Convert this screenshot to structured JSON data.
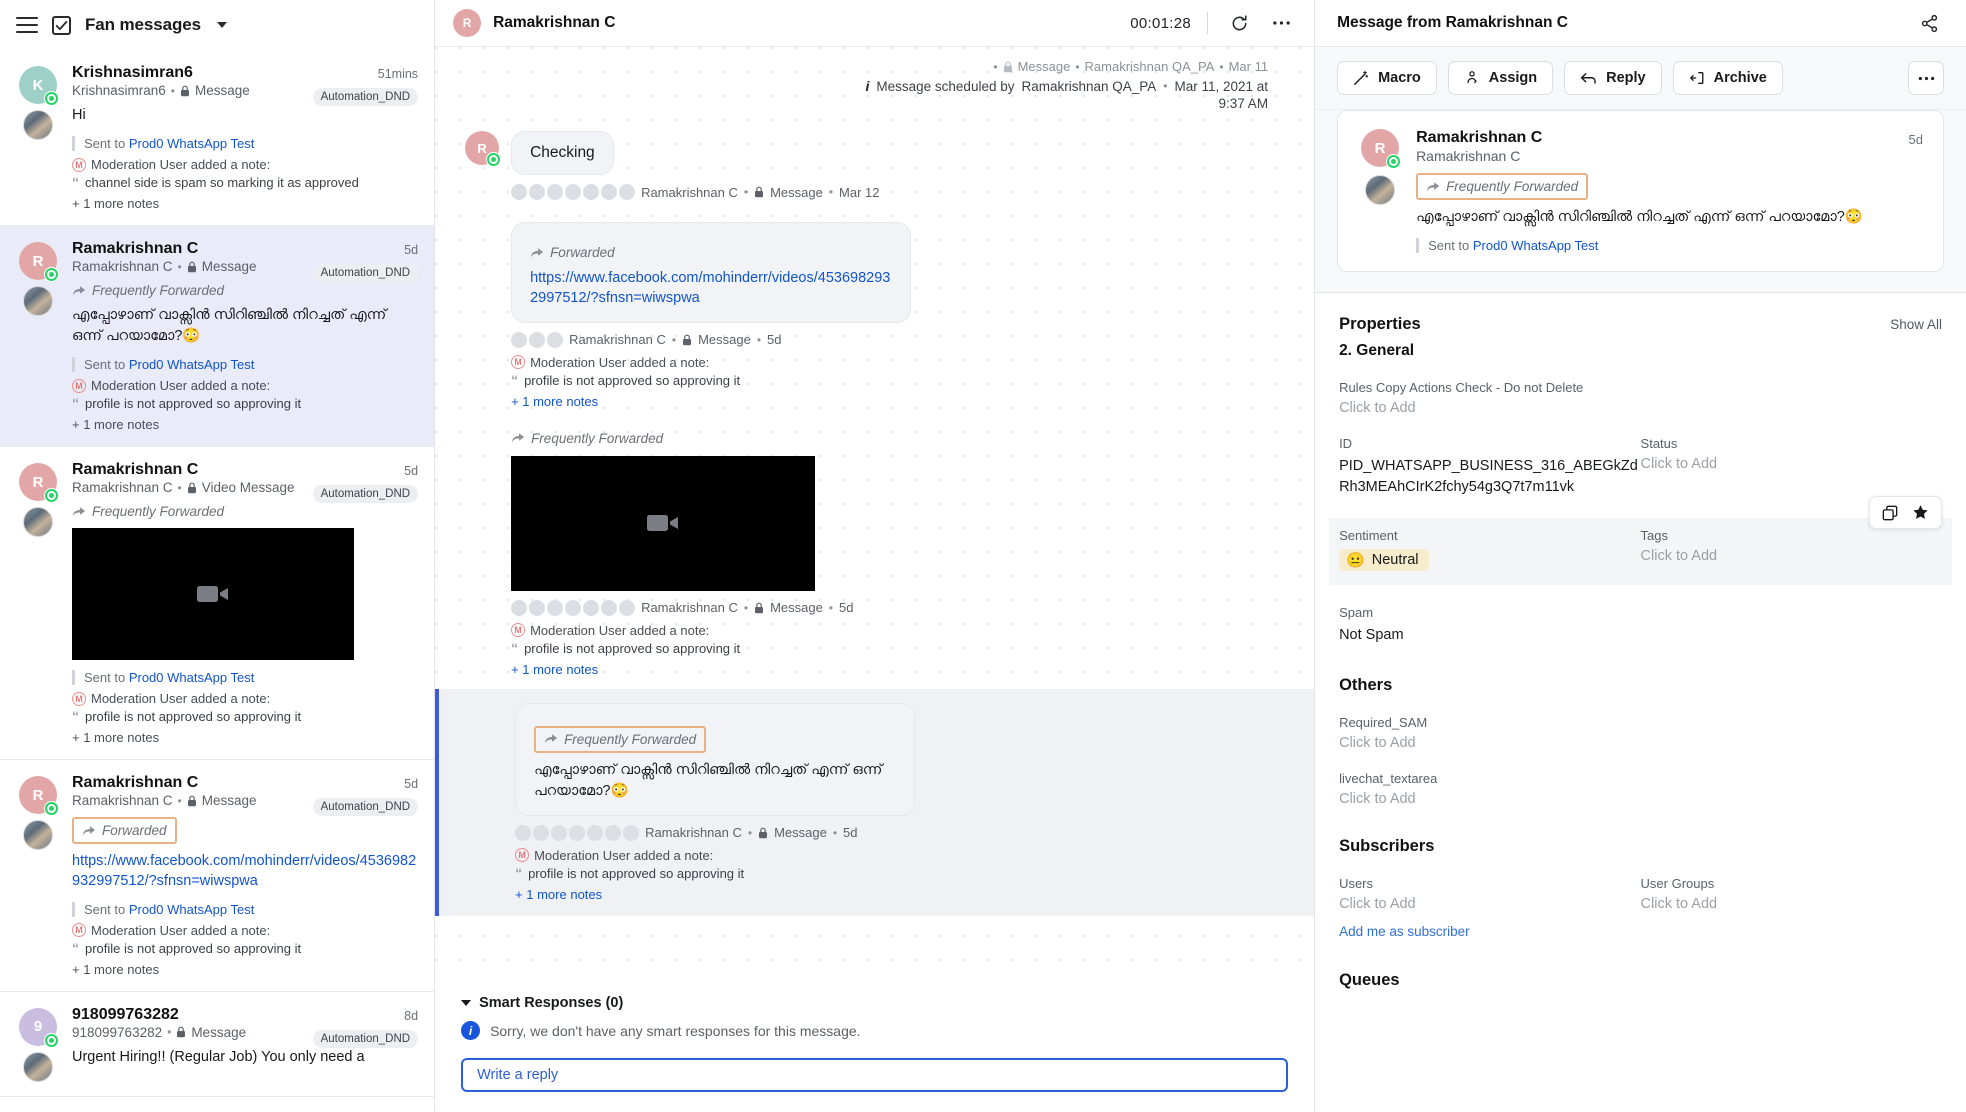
{
  "left": {
    "header": {
      "title": "Fan messages",
      "menu_icon": "hamburger-icon",
      "select_icon": "checkbox-icon",
      "chevron": "chevron-down-icon"
    },
    "conversations": [
      {
        "name": "Krishnasimran6",
        "sub_name": "Krishnasimran6",
        "channel": "Message",
        "time": "51mins",
        "tag": "Automation_DND",
        "avatar_letter": "K",
        "avatar_color": "#9fd0c8",
        "forwarded_label": "",
        "body_text": "Hi",
        "link": "",
        "has_video": false,
        "sent_to_prefix": "Sent to",
        "sent_to_link": "Prod0 WhatsApp Test",
        "note_author": "Moderation User added a note:",
        "note_text": "channel side is spam so marking it as approved",
        "more_notes": "+ 1 more notes",
        "selected": false
      },
      {
        "name": "Ramakrishnan C",
        "sub_name": "Ramakrishnan C",
        "channel": "Message",
        "time": "5d",
        "tag": "Automation_DND",
        "avatar_letter": "R",
        "avatar_color": "#e2a6a6",
        "forwarded_label": "Frequently Forwarded",
        "forwarded_boxed": false,
        "body_text": "എപ്പോഴാണ് വാക്സിൻ സിറിഞ്ചിൽ നിറച്ചത് എന്ന് ഒന്ന് പറയാമോ?😳",
        "link": "",
        "has_video": false,
        "sent_to_prefix": "Sent to",
        "sent_to_link": "Prod0 WhatsApp Test",
        "note_author": "Moderation User added a note:",
        "note_text": "profile is not approved so approving it",
        "more_notes": "+ 1 more notes",
        "selected": true
      },
      {
        "name": "Ramakrishnan C",
        "sub_name": "Ramakrishnan C",
        "channel": "Video Message",
        "time": "5d",
        "tag": "Automation_DND",
        "avatar_letter": "R",
        "avatar_color": "#e2a6a6",
        "forwarded_label": "Frequently Forwarded",
        "forwarded_boxed": false,
        "body_text": "",
        "link": "",
        "has_video": true,
        "sent_to_prefix": "Sent to",
        "sent_to_link": "Prod0 WhatsApp Test",
        "note_author": "Moderation User added a note:",
        "note_text": "profile is not approved so approving it",
        "more_notes": "+ 1 more notes",
        "selected": false
      },
      {
        "name": "Ramakrishnan C",
        "sub_name": "Ramakrishnan C",
        "channel": "Message",
        "time": "5d",
        "tag": "Automation_DND",
        "avatar_letter": "R",
        "avatar_color": "#e2a6a6",
        "forwarded_label": "Forwarded",
        "forwarded_boxed": true,
        "body_text": "",
        "link": "https://www.facebook.com/mohinderr/videos/4536982932997512/?sfnsn=wiwspwa",
        "has_video": false,
        "sent_to_prefix": "Sent to",
        "sent_to_link": "Prod0 WhatsApp Test",
        "note_author": "Moderation User added a note:",
        "note_text": "profile is not approved so approving it",
        "more_notes": "+ 1 more notes",
        "selected": false
      },
      {
        "name": "918099763282",
        "sub_name": "918099763282",
        "channel": "Message",
        "time": "8d",
        "tag": "Automation_DND",
        "avatar_letter": "9",
        "avatar_color": "#c9bde0",
        "forwarded_label": "",
        "body_text": "Urgent Hiring!! (Regular Job) You only need a",
        "link": "",
        "has_video": false,
        "sent_to_prefix": "",
        "sent_to_link": "",
        "note_author": "",
        "note_text": "",
        "more_notes": "",
        "selected": false
      }
    ]
  },
  "center": {
    "header": {
      "avatar_letter": "R",
      "title": "Ramakrishnan C",
      "timer": "00:01:28",
      "refresh_icon": "refresh-icon",
      "more_icon": "ellipsis-icon"
    },
    "scheduled": {
      "line1_meta": "Message",
      "line1_author": "Ramakrishnan QA_PA",
      "line1_date": "Mar 11",
      "prefix": "Message scheduled by",
      "author": "Ramakrishnan QA_PA",
      "date": "Mar 11, 2021 at",
      "time": "9:37 AM"
    },
    "messages": [
      {
        "type": "text",
        "avatar_letter": "R",
        "text": "Checking",
        "meta_author": "Ramakrishnan C",
        "meta_channel": "Message",
        "meta_time": "Mar 12"
      },
      {
        "type": "link",
        "forwarded_label": "Forwarded",
        "link": "https://www.facebook.com/mohinderr/videos/4536982932997512/?sfnsn=wiwspwa",
        "meta_author": "Ramakrishnan C",
        "meta_channel": "Message",
        "meta_time": "5d",
        "note_author": "Moderation User added a note:",
        "note_text": "profile is not approved so approving it",
        "more_notes": "+ 1 more notes"
      },
      {
        "type": "video",
        "forwarded_label": "Frequently Forwarded",
        "meta_author": "Ramakrishnan C",
        "meta_channel": "Message",
        "meta_time": "5d",
        "note_author": "Moderation User added a note:",
        "note_text": "profile is not approved so approving it",
        "more_notes": "+ 1 more notes"
      },
      {
        "type": "highlight",
        "forwarded_label": "Frequently Forwarded",
        "text": "എപ്പോഴാണ് വാക്സിൻ സിറിഞ്ചിൽ നിറച്ചത് എന്ന് ഒന്ന് പറയാമോ?😳",
        "meta_author": "Ramakrishnan C",
        "meta_channel": "Message",
        "meta_time": "5d",
        "note_author": "Moderation User added a note:",
        "note_text": "profile is not approved so approving it",
        "more_notes": "+ 1 more notes"
      }
    ],
    "smart_responses": {
      "title": "Smart Responses (0)",
      "empty_text": "Sorry, we don't have any smart responses for this message."
    },
    "reply": {
      "placeholder": "Write a reply"
    }
  },
  "right": {
    "header": {
      "title": "Message from Ramakrishnan C",
      "share_icon": "share-icon"
    },
    "actions": {
      "macro": "Macro",
      "assign": "Assign",
      "reply": "Reply",
      "archive": "Archive",
      "more": "ellipsis-icon"
    },
    "card": {
      "name": "Ramakrishnan C",
      "sub_name": "Ramakrishnan C",
      "time": "5d",
      "avatar_letter": "R",
      "forwarded_label": "Frequently Forwarded",
      "body_text": "എപ്പോഴാണ് വാക്സിൻ സിറിഞ്ചിൽ നിറച്ചത് എന്ന് ഒന്ന് പറയാമോ?😳",
      "sent_to_prefix": "Sent to",
      "sent_to_link": "Prod0 WhatsApp Test"
    },
    "properties": {
      "title": "Properties",
      "show_all": "Show All",
      "subtitle": "2. General",
      "rules_label": "Rules Copy Actions Check - Do not Delete",
      "rules_value": "Click to Add",
      "id_label": "ID",
      "id_value": "PID_WHATSAPP_BUSINESS_316_ABEGkZdRh3MEAhCIrK2fchy54g3Q7t7m11vk",
      "status_label": "Status",
      "status_value": "Click to Add",
      "sentiment_label": "Sentiment",
      "sentiment_value": "Neutral",
      "sentiment_emoji": "😐",
      "tags_label": "Tags",
      "tags_value": "Click to Add",
      "spam_label": "Spam",
      "spam_value": "Not Spam",
      "copy_icon": "copy-icon",
      "star_icon": "star-icon"
    },
    "others": {
      "title": "Others",
      "required_sam_label": "Required_SAM",
      "required_sam_value": "Click to Add",
      "livechat_label": "livechat_textarea",
      "livechat_value": "Click to Add"
    },
    "subscribers": {
      "title": "Subscribers",
      "users_label": "Users",
      "users_value": "Click to Add",
      "groups_label": "User Groups",
      "groups_value": "Click to Add",
      "add_me": "Add me as subscriber"
    },
    "queues": {
      "title": "Queues"
    }
  },
  "colors": {
    "accent_blue": "#2c5fd6",
    "link_blue": "#1155cc",
    "highlight_orange": "#e8b184",
    "selected_bg": "#e9ebf8",
    "sentiment_bg": "#f7eccb"
  }
}
